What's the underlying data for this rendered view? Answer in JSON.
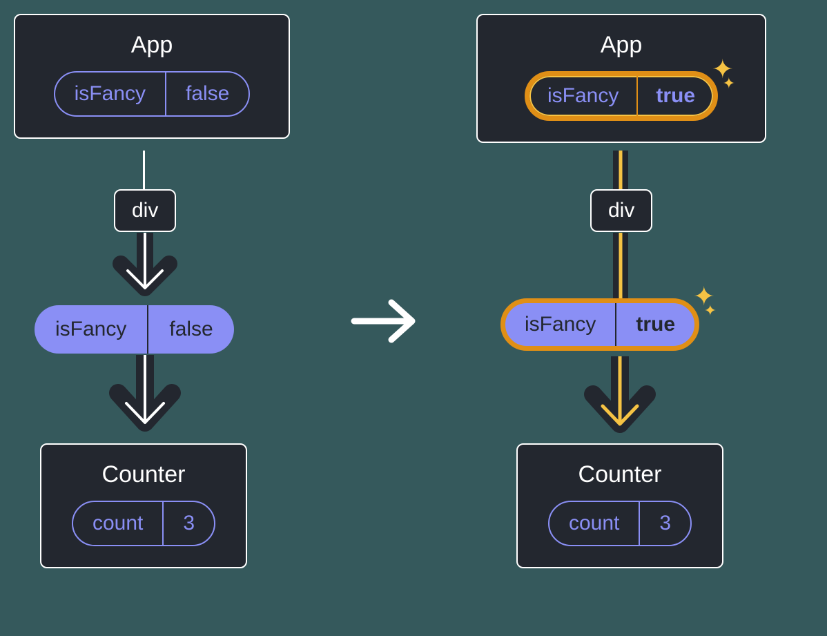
{
  "left": {
    "app": {
      "title": "App",
      "state": {
        "key": "isFancy",
        "value": "false"
      }
    },
    "div": "div",
    "prop": {
      "key": "isFancy",
      "value": "false"
    },
    "counter": {
      "title": "Counter",
      "state": {
        "key": "count",
        "value": "3"
      }
    }
  },
  "right": {
    "app": {
      "title": "App",
      "state": {
        "key": "isFancy",
        "value": "true"
      }
    },
    "div": "div",
    "prop": {
      "key": "isFancy",
      "value": "true"
    },
    "counter": {
      "title": "Counter",
      "state": {
        "key": "count",
        "value": "3"
      }
    }
  },
  "colors": {
    "bg": "#35595c",
    "nodeBg": "#23272f",
    "accent": "#8a8ff5",
    "highlight": "#f6c344",
    "highlightBorder": "#e08f16"
  }
}
